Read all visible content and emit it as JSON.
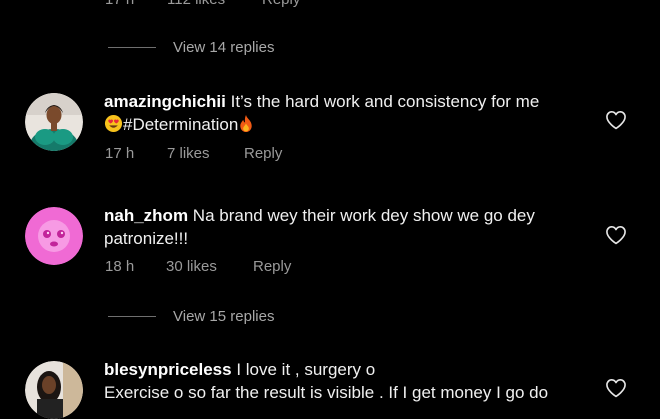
{
  "top_cropped_meta": {
    "time": "17 h",
    "likes": "112 likes",
    "reply": "Reply"
  },
  "view_replies_1": "View 14 replies",
  "comments": [
    {
      "username": "amazingchichii",
      "text_line1": "It’s the hard work and consistency for me",
      "text_line2": "#Determination",
      "time": "17 h",
      "likes": "7 likes",
      "reply": "Reply",
      "like_icon": "heart-outline-icon"
    },
    {
      "username": "nah_zhom",
      "text_line1": "Na brand wey their work dey show we go dey",
      "text_line2": "patronize!!!",
      "time": "18 h",
      "likes": "30 likes",
      "reply": "Reply",
      "like_icon": "heart-outline-icon"
    },
    {
      "username": "blesynpriceless",
      "text_line1": "I love it , surgery o",
      "text_line2": "Exercise o so far the result is visible . If I get money I go do",
      "like_icon": "heart-outline-icon"
    }
  ],
  "view_replies_2": "View 15 replies"
}
